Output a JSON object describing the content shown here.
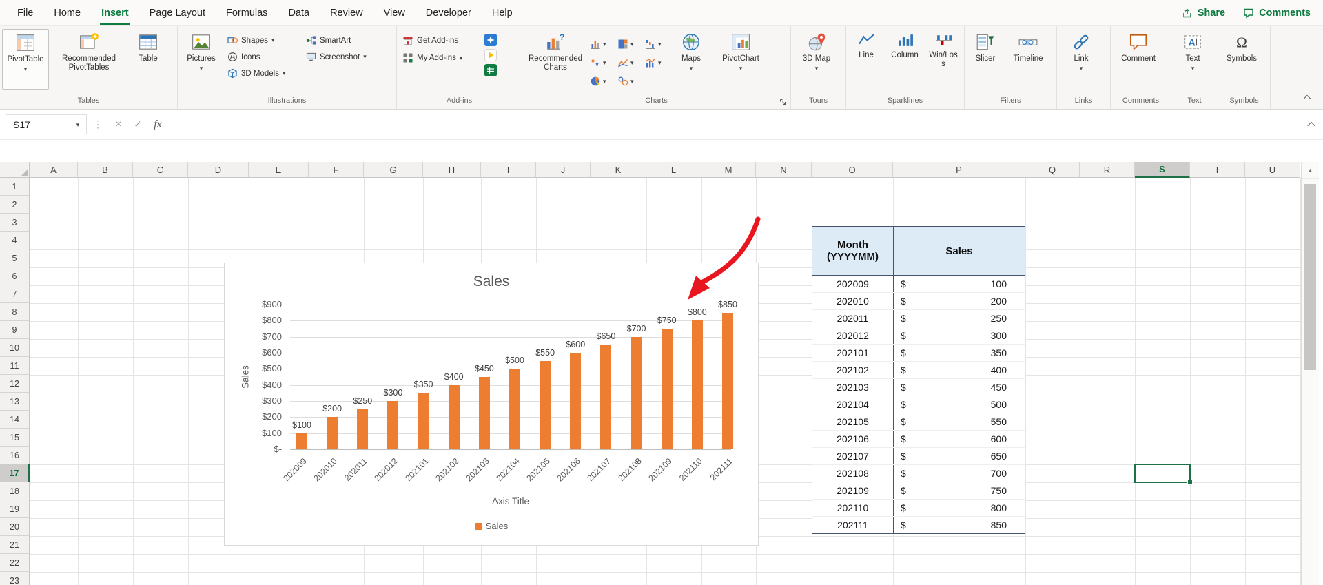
{
  "ribbon": {
    "tabs": [
      "File",
      "Home",
      "Insert",
      "Page Layout",
      "Formulas",
      "Data",
      "Review",
      "View",
      "Developer",
      "Help"
    ],
    "active_tab": "Insert",
    "share_label": "Share",
    "comments_label": "Comments",
    "groups": {
      "tables": {
        "label": "Tables",
        "items": {
          "pivottable": "PivotTable",
          "recommended_pivottables": "Recommended PivotTables",
          "table": "Table"
        }
      },
      "illustrations": {
        "label": "Illustrations",
        "items": {
          "pictures": "Pictures",
          "shapes": "Shapes",
          "icons": "Icons",
          "models_3d": "3D Models",
          "smartart": "SmartArt",
          "screenshot": "Screenshot"
        }
      },
      "addins": {
        "label": "Add-ins",
        "items": {
          "get_addins": "Get Add-ins",
          "my_addins": "My Add-ins"
        }
      },
      "charts": {
        "label": "Charts",
        "items": {
          "recommended_charts": "Recommended Charts",
          "maps": "Maps",
          "pivotchart": "PivotChart"
        }
      },
      "tours": {
        "label": "Tours",
        "items": {
          "map_3d": "3D Map"
        }
      },
      "sparklines": {
        "label": "Sparklines",
        "items": {
          "line": "Line",
          "column": "Column",
          "winloss": "Win/Loss"
        }
      },
      "filters": {
        "label": "Filters",
        "items": {
          "slicer": "Slicer",
          "timeline": "Timeline"
        }
      },
      "links": {
        "label": "Links",
        "items": {
          "link": "Link"
        }
      },
      "comments": {
        "label": "Comments",
        "items": {
          "comment": "Comment"
        }
      },
      "text": {
        "label": "Text",
        "items": {
          "text": "Text"
        }
      },
      "symbols": {
        "label": "Symbols",
        "items": {
          "symbols": "Symbols"
        }
      }
    }
  },
  "formula_bar": {
    "name_box": "S17",
    "formula": ""
  },
  "grid": {
    "column_headers": [
      "A",
      "B",
      "C",
      "D",
      "E",
      "F",
      "G",
      "H",
      "I",
      "J",
      "K",
      "L",
      "M",
      "N",
      "O",
      "P",
      "Q",
      "R",
      "S",
      "T",
      "U"
    ],
    "row_headers": [
      "1",
      "2",
      "3",
      "4",
      "5",
      "6",
      "7",
      "8",
      "9",
      "10",
      "11",
      "12",
      "13",
      "14",
      "15",
      "16",
      "17",
      "18",
      "19",
      "20",
      "21",
      "22",
      "23"
    ],
    "selected_column": "S",
    "selected_row": "17",
    "active_cell": "S17"
  },
  "sheet_table": {
    "header_month": "Month (YYYYMM)",
    "header_sales": "Sales",
    "currency": "$",
    "rows": [
      {
        "month": "202009",
        "value": "100"
      },
      {
        "month": "202010",
        "value": "200"
      },
      {
        "month": "202011",
        "value": "250",
        "group_border": true
      },
      {
        "month": "202012",
        "value": "300"
      },
      {
        "month": "202101",
        "value": "350"
      },
      {
        "month": "202102",
        "value": "400"
      },
      {
        "month": "202103",
        "value": "450"
      },
      {
        "month": "202104",
        "value": "500"
      },
      {
        "month": "202105",
        "value": "550"
      },
      {
        "month": "202106",
        "value": "600"
      },
      {
        "month": "202107",
        "value": "650"
      },
      {
        "month": "202108",
        "value": "700"
      },
      {
        "month": "202109",
        "value": "750"
      },
      {
        "month": "202110",
        "value": "800"
      },
      {
        "month": "202111",
        "value": "850"
      }
    ]
  },
  "chart_data": {
    "type": "bar",
    "title": "Sales",
    "categories": [
      "202009",
      "202010",
      "202011",
      "202012",
      "202101",
      "202102",
      "202103",
      "202104",
      "202105",
      "202106",
      "202107",
      "202108",
      "202109",
      "202110",
      "202111"
    ],
    "values": [
      100,
      200,
      250,
      300,
      350,
      400,
      450,
      500,
      550,
      600,
      650,
      700,
      750,
      800,
      850
    ],
    "data_labels": [
      "$100",
      "$200",
      "$250",
      "$300",
      "$350",
      "$400",
      "$450",
      "$500",
      "$550",
      "$600",
      "$650",
      "$700",
      "$750",
      "$800",
      "$850"
    ],
    "xlabel": "Axis Title",
    "ylabel": "Sales",
    "ylim": [
      0,
      900
    ],
    "ytick_step": 100,
    "ytick_labels": [
      "$-",
      "$100",
      "$200",
      "$300",
      "$400",
      "$500",
      "$600",
      "$700",
      "$800",
      "$900"
    ],
    "legend": [
      "Sales"
    ],
    "legend_position": "bottom",
    "bar_color": "#ED7D31",
    "grid": true
  },
  "annotation": {
    "type": "hand-drawn-arrow",
    "color": "#E8171F"
  }
}
